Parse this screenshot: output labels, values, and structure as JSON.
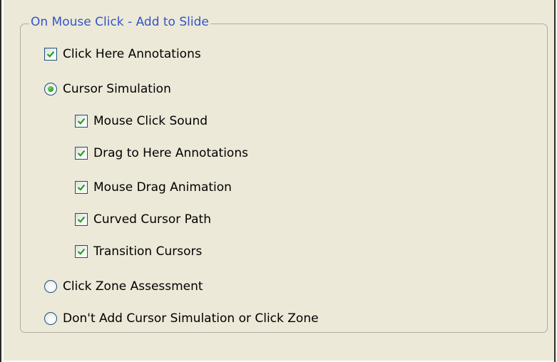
{
  "group": {
    "title": "On Mouse Click - Add to Slide"
  },
  "options": {
    "click_here_annotations": {
      "label": "Click Here Annotations",
      "checked": true
    },
    "cursor_simulation": {
      "label": "Cursor Simulation",
      "selected": true
    },
    "mouse_click_sound": {
      "label": "Mouse Click Sound",
      "checked": true
    },
    "drag_to_here_annotations": {
      "label": "Drag to Here Annotations",
      "checked": true
    },
    "mouse_drag_animation": {
      "label": "Mouse Drag Animation",
      "checked": true
    },
    "curved_cursor_path": {
      "label": "Curved Cursor Path",
      "checked": true
    },
    "transition_cursors": {
      "label": "Transition Cursors",
      "checked": true
    },
    "click_zone_assessment": {
      "label": "Click Zone Assessment",
      "selected": false
    },
    "no_cursor_simulation": {
      "label": "Don't Add Cursor Simulation or Click Zone",
      "selected": false
    }
  },
  "colors": {
    "group_title": "#3454c8",
    "check_mark": "#21a121",
    "control_border": "#1c5180"
  },
  "icons": {
    "check": "check-icon",
    "radio_dot": "radio-dot-icon"
  }
}
